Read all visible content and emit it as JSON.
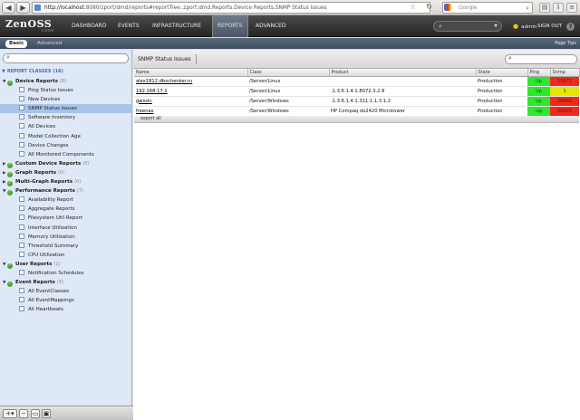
{
  "browser": {
    "url_host": "http://localhost",
    "url_path": ":8080/zport/dmd/reports#reportTree:.zport.dmd.Reports.Device Reports.SNMP Status Issues",
    "search_engine": "Google"
  },
  "app": {
    "logo": "ZenOSS",
    "logo_sub": "CORE",
    "nav": [
      "DASHBOARD",
      "EVENTS",
      "INFRASTRUCTURE",
      "REPORTS",
      "ADVANCED"
    ],
    "active_nav": "REPORTS",
    "user": "admin",
    "signout": "SIGN OUT",
    "subtabs": [
      "Basic",
      "Advanced"
    ],
    "page_tips": "Page Tips"
  },
  "sidebar": {
    "root_label": "REPORT CLASSES",
    "root_count": "(16)",
    "folders": [
      {
        "label": "Device Reports",
        "count": "(8)",
        "items": [
          "Ping Status Issues",
          "New Devices",
          "SNMP Status Issues",
          "Software Inventory",
          "All Devices",
          "Model Collection Age",
          "Device Changes",
          "All Monitored Components"
        ]
      },
      {
        "label": "Custom Device Reports",
        "count": "(0)",
        "items": []
      },
      {
        "label": "Graph Reports",
        "count": "(0)",
        "items": []
      },
      {
        "label": "Multi-Graph Reports",
        "count": "(0)",
        "items": []
      },
      {
        "label": "Performance Reports",
        "count": "(7)",
        "items": [
          "Availability Report",
          "Aggregate Reports",
          "Filesystem Util Report",
          "Interface Utilization",
          "Memory Utilization",
          "Threshold Summary",
          "CPU Utilization"
        ]
      },
      {
        "label": "User Reports",
        "count": "(1)",
        "items": [
          "Notification Schedules"
        ]
      },
      {
        "label": "Event Reports",
        "count": "(3)",
        "items": [
          "All EventClasses",
          "All EventMappings",
          "All Heartbeats"
        ]
      }
    ],
    "selected": "SNMP Status Issues"
  },
  "main": {
    "title": "SNMP Status Issues",
    "columns": [
      "Name",
      "Class",
      "Product",
      "State",
      "Ping",
      "Snmp"
    ],
    "rows": [
      {
        "name": "alex1812.dbschenker.ru",
        "class": "/Server/Linux",
        "product": "",
        "state": "Production",
        "ping": "Up",
        "snmp": "13677",
        "snmp_color": "#f02a1a"
      },
      {
        "name": "192.168.17.1",
        "class": "/Server/Linux",
        "product": ".1.3.6.1.4.1.8072.3.2.8",
        "state": "Production",
        "ping": "Up",
        "snmp": "1",
        "snmp_color": "#e8e600"
      },
      {
        "name": "gwsstc",
        "class": "/Server/Windows",
        "product": ".1.3.6.1.4.1.311.1.1.3.1.2",
        "state": "Production",
        "ping": "Up",
        "snmp": "29940",
        "snmp_color": "#f02a1a"
      },
      {
        "name": "freenas",
        "class": "/Server/Windows",
        "product": "HP Compaq dx2420 Microtower",
        "state": "Production",
        "ping": "Up",
        "snmp": "29825",
        "snmp_color": "#f02a1a"
      }
    ],
    "export_label": "export all"
  },
  "colors": {
    "ping_up": "#2ee82e",
    "selected_row": "#a6c3ea",
    "nav_active": "#5a6678"
  }
}
